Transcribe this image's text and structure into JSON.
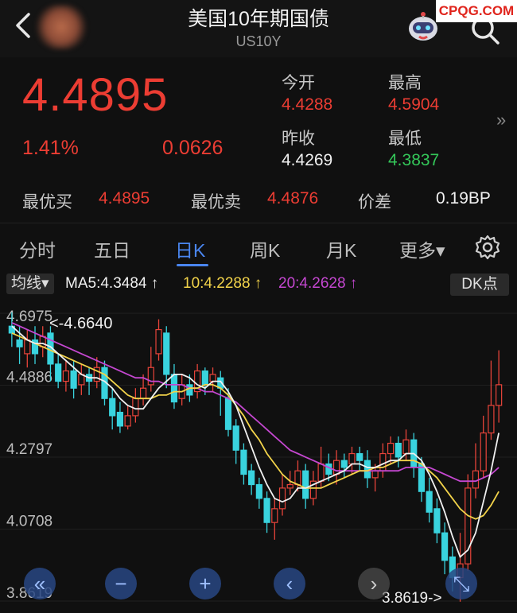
{
  "header": {
    "title": "美国10年期国债",
    "subtitle": "US10Y",
    "watermark": "CPQG.COM"
  },
  "quote": {
    "price": "4.4895",
    "change_pct": "1.41%",
    "change": "0.0626",
    "open_label": "今开",
    "open": "4.4288",
    "high_label": "最高",
    "high": "4.5904",
    "prev_close_label": "昨收",
    "prev_close": "4.4269",
    "low_label": "最低",
    "low": "4.3837",
    "more": "»"
  },
  "best": {
    "bid_label": "最优买",
    "bid": "4.4895",
    "ask_label": "最优卖",
    "ask": "4.4876",
    "spread_label": "价差",
    "spread": "0.19BP"
  },
  "tabs": [
    {
      "label": "分时"
    },
    {
      "label": "五日"
    },
    {
      "label": "日K"
    },
    {
      "label": "周K"
    },
    {
      "label": "月K"
    },
    {
      "label": "更多▾"
    }
  ],
  "legend": {
    "ma_button": "均线▾",
    "ma5": "MA5:4.3484 ↑",
    "ma10": "10:4.2288 ↑",
    "ma20": "20:4.2628 ↑",
    "dk_button": "DK点"
  },
  "chart_data": {
    "type": "candlestick",
    "y_ticks": [
      "4.6975",
      "4.4886",
      "4.2797",
      "4.0708",
      "3.8619"
    ],
    "ylim": [
      3.8619,
      4.6975
    ],
    "max_annotation": "<-4.6640",
    "min_annotation": "3.8619->",
    "candles": [
      [
        4.66,
        4.64,
        4.7,
        4.6
      ],
      [
        4.62,
        4.6,
        4.66,
        4.55
      ],
      [
        4.58,
        4.62,
        4.65,
        4.54
      ],
      [
        4.62,
        4.58,
        4.66,
        4.55
      ],
      [
        4.6,
        4.63,
        4.66,
        4.57
      ],
      [
        4.64,
        4.55,
        4.66,
        4.5
      ],
      [
        4.55,
        4.5,
        4.58,
        4.48
      ],
      [
        4.5,
        4.53,
        4.56,
        4.47
      ],
      [
        4.53,
        4.48,
        4.56,
        4.45
      ],
      [
        4.49,
        4.52,
        4.55,
        4.46
      ],
      [
        4.52,
        4.5,
        4.54,
        4.46
      ],
      [
        4.5,
        4.54,
        4.57,
        4.48
      ],
      [
        4.54,
        4.45,
        4.56,
        4.43
      ],
      [
        4.45,
        4.4,
        4.48,
        4.36
      ],
      [
        4.41,
        4.37,
        4.44,
        4.35
      ],
      [
        4.37,
        4.4,
        4.43,
        4.36
      ],
      [
        4.4,
        4.45,
        4.48,
        4.38
      ],
      [
        4.45,
        4.48,
        4.52,
        4.43
      ],
      [
        4.49,
        4.54,
        4.6,
        4.47
      ],
      [
        4.58,
        4.65,
        4.68,
        4.56
      ],
      [
        4.64,
        4.52,
        4.66,
        4.48
      ],
      [
        4.52,
        4.44,
        4.55,
        4.42
      ],
      [
        4.45,
        4.49,
        4.52,
        4.43
      ],
      [
        4.49,
        4.46,
        4.52,
        4.44
      ],
      [
        4.47,
        4.53,
        4.55,
        4.45
      ],
      [
        4.53,
        4.49,
        4.54,
        4.46
      ],
      [
        4.5,
        4.52,
        4.54,
        4.47
      ],
      [
        4.51,
        4.48,
        4.53,
        4.4
      ],
      [
        4.45,
        4.36,
        4.48,
        4.34
      ],
      [
        4.37,
        4.3,
        4.39,
        4.26
      ],
      [
        4.3,
        4.23,
        4.32,
        4.2
      ],
      [
        4.24,
        4.2,
        4.26,
        4.17
      ],
      [
        4.2,
        4.16,
        4.22,
        4.13
      ],
      [
        4.16,
        4.09,
        4.18,
        4.06
      ],
      [
        4.09,
        4.13,
        4.16,
        4.04
      ],
      [
        4.13,
        4.19,
        4.23,
        4.11
      ],
      [
        4.19,
        4.2,
        4.24,
        4.17
      ],
      [
        4.2,
        4.24,
        4.27,
        4.18
      ],
      [
        4.24,
        4.16,
        4.26,
        4.13
      ],
      [
        4.16,
        4.21,
        4.24,
        4.14
      ],
      [
        4.21,
        4.26,
        4.31,
        4.19
      ],
      [
        4.26,
        4.23,
        4.29,
        4.21
      ],
      [
        4.23,
        4.27,
        4.3,
        4.2
      ],
      [
        4.27,
        4.25,
        4.29,
        4.22
      ],
      [
        4.26,
        4.29,
        4.31,
        4.23
      ],
      [
        4.29,
        4.27,
        4.31,
        4.24
      ],
      [
        4.27,
        4.22,
        4.3,
        4.19
      ],
      [
        4.22,
        4.24,
        4.26,
        4.18
      ],
      [
        4.24,
        4.29,
        4.32,
        4.22
      ],
      [
        4.29,
        4.32,
        4.34,
        4.26
      ],
      [
        4.32,
        4.28,
        4.34,
        4.25
      ],
      [
        4.29,
        4.33,
        4.36,
        4.27
      ],
      [
        4.33,
        4.25,
        4.35,
        4.22
      ],
      [
        4.26,
        4.18,
        4.28,
        4.15
      ],
      [
        4.18,
        4.12,
        4.22,
        4.09
      ],
      [
        4.13,
        4.06,
        4.16,
        4.03
      ],
      [
        4.06,
        3.98,
        4.09,
        3.94
      ],
      [
        3.99,
        3.93,
        4.02,
        3.89
      ],
      [
        3.93,
        3.97,
        4.06,
        3.86
      ],
      [
        3.97,
        4.19,
        4.23,
        3.95
      ],
      [
        4.19,
        4.24,
        4.32,
        4.16
      ],
      [
        4.24,
        4.35,
        4.4,
        4.22
      ],
      [
        4.35,
        4.43,
        4.56,
        4.33
      ],
      [
        4.43,
        4.49,
        4.59,
        4.38
      ]
    ],
    "ma5": [
      4.66,
      4.64,
      4.62,
      4.61,
      4.61,
      4.6,
      4.58,
      4.56,
      4.54,
      4.52,
      4.51,
      4.51,
      4.5,
      4.48,
      4.45,
      4.43,
      4.42,
      4.42,
      4.45,
      4.48,
      4.5,
      4.52,
      4.52,
      4.51,
      4.49,
      4.48,
      4.5,
      4.5,
      4.47,
      4.43,
      4.37,
      4.31,
      4.25,
      4.2,
      4.16,
      4.15,
      4.16,
      4.19,
      4.19,
      4.2,
      4.21,
      4.22,
      4.23,
      4.24,
      4.26,
      4.26,
      4.25,
      4.25,
      4.26,
      4.27,
      4.27,
      4.29,
      4.29,
      4.27,
      4.23,
      4.18,
      4.12,
      4.05,
      3.99,
      4.01,
      4.06,
      4.15,
      4.24,
      4.35
    ],
    "ma10": [
      4.64,
      4.63,
      4.62,
      4.61,
      4.6,
      4.59,
      4.58,
      4.57,
      4.56,
      4.55,
      4.54,
      4.53,
      4.52,
      4.5,
      4.48,
      4.46,
      4.45,
      4.45,
      4.45,
      4.46,
      4.46,
      4.47,
      4.47,
      4.48,
      4.48,
      4.49,
      4.49,
      4.48,
      4.46,
      4.43,
      4.4,
      4.36,
      4.33,
      4.29,
      4.26,
      4.23,
      4.21,
      4.2,
      4.19,
      4.19,
      4.19,
      4.2,
      4.21,
      4.22,
      4.23,
      4.24,
      4.24,
      4.25,
      4.25,
      4.26,
      4.27,
      4.27,
      4.27,
      4.26,
      4.24,
      4.22,
      4.19,
      4.16,
      4.13,
      4.11,
      4.1,
      4.11,
      4.14,
      4.18
    ],
    "ma20": [
      4.67,
      4.66,
      4.65,
      4.64,
      4.63,
      4.62,
      4.61,
      4.6,
      4.59,
      4.58,
      4.57,
      4.56,
      4.55,
      4.54,
      4.53,
      4.52,
      4.51,
      4.51,
      4.5,
      4.5,
      4.49,
      4.49,
      4.49,
      4.48,
      4.48,
      4.47,
      4.47,
      4.46,
      4.45,
      4.44,
      4.42,
      4.4,
      4.38,
      4.36,
      4.34,
      4.32,
      4.3,
      4.29,
      4.28,
      4.27,
      4.26,
      4.25,
      4.24,
      4.24,
      4.24,
      4.24,
      4.24,
      4.24,
      4.24,
      4.24,
      4.24,
      4.25,
      4.25,
      4.25,
      4.25,
      4.24,
      4.23,
      4.22,
      4.21,
      4.21,
      4.21,
      4.22,
      4.23,
      4.25
    ]
  },
  "controls": [
    "«",
    "−",
    "+",
    "‹",
    "›",
    "⤡"
  ],
  "colors": {
    "up": "#e8443a",
    "down": "#39d3de",
    "ma5": "#f0f0f0",
    "ma10": "#f2d34a",
    "ma20": "#c447d0",
    "accent": "#4a86f0"
  }
}
